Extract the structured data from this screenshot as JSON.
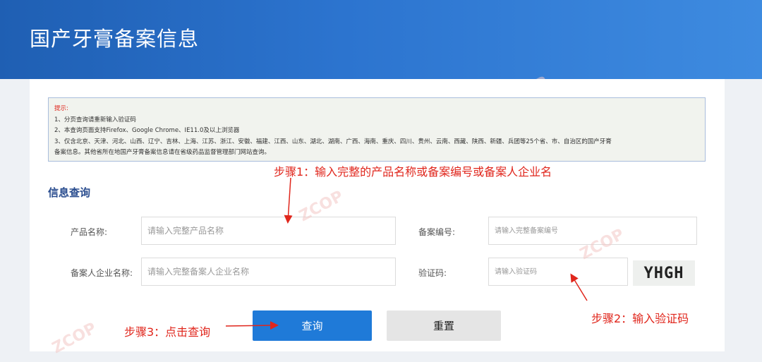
{
  "header": {
    "title": "国产牙膏备案信息"
  },
  "notice": {
    "heading": "提示:",
    "lines": [
      "1、分页查询请重新输入验证码",
      "2、本查询页面支持Firefox、Google Chrome、IE11.0及以上浏览器",
      "3、仅含北京、天津、河北、山西、辽宁、吉林、上海、江苏、浙江、安徽、福建、江西、山东、湖北、湖南、广西、海南、重庆、四川、贵州、云南、西藏、陕西、新疆、兵团等25个省、市、自治区的国产牙膏",
      "备案信息。其他省所在地国产牙膏备案信息请在省级药品监督管理部门网站查询。"
    ]
  },
  "form": {
    "section_title": "信息查询",
    "product_name": {
      "label": "产品名称:",
      "placeholder": "请输入完整产品名称"
    },
    "record_no": {
      "label": "备案编号:",
      "placeholder": "请输入完整备案编号"
    },
    "company_name": {
      "label": "备案人企业名称:",
      "placeholder": "请输入完整备案人企业名称"
    },
    "captcha": {
      "label": "验证码:",
      "placeholder": "请输入验证码",
      "image_text": "YHGH"
    },
    "query_button": "查询",
    "reset_button": "重置"
  },
  "annotations": {
    "step1": "步骤1：输入完整的产品名称或备案编号或备案人企业名",
    "step2": "步骤2：输入验证码",
    "step3": "步骤3：点击查询",
    "color": "#e0261c"
  },
  "watermark": {
    "text": "ZCOP"
  }
}
